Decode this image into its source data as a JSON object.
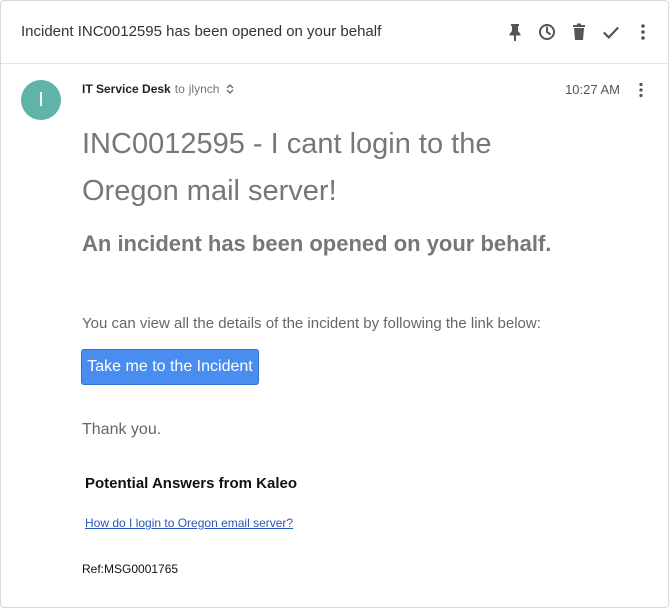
{
  "header": {
    "subject": "Incident INC0012595 has been opened on your behalf",
    "actions": [
      {
        "name": "pin-icon"
      },
      {
        "name": "snooze-icon"
      },
      {
        "name": "trash-icon"
      },
      {
        "name": "done-icon"
      },
      {
        "name": "more-vertical-icon"
      }
    ]
  },
  "message": {
    "avatar_initial": "I",
    "avatar_color": "#5fb3a7",
    "sender": "IT Service Desk",
    "to_prefix": "to",
    "recipient": "jlynch",
    "time": "10:27 AM",
    "title": "INC0012595 - I cant login to the Oregon mail server!",
    "subtitle": "An incident has been opened on your behalf.",
    "description": "You can view all the details of the incident by following the link below:",
    "cta_label": "Take me to the Incident",
    "cta_color": "#4a8df0",
    "thanks": "Thank you.",
    "kaleo_heading": "Potential Answers from Kaleo",
    "kaleo_link": "How do I login to Oregon email server?",
    "ref": "Ref:MSG0001765"
  }
}
